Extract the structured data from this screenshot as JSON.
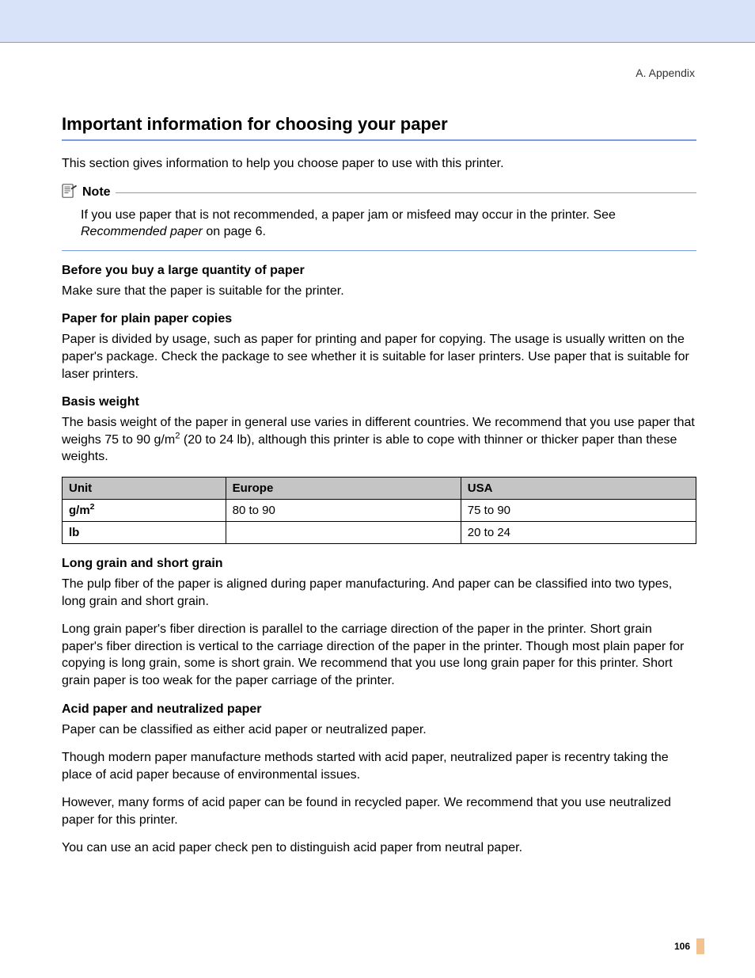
{
  "breadcrumb": "A. Appendix",
  "title": "Important information for choosing your paper",
  "intro": "This section gives information to help you choose paper to use with this printer.",
  "note": {
    "label": "Note",
    "body_prefix": "If you use paper that is not recommended, a paper jam or misfeed may occur in the printer. See ",
    "body_link": "Recommended paper",
    "body_suffix": " on page 6."
  },
  "sections": {
    "before_buy": {
      "heading": "Before you buy a large quantity of paper",
      "p1": "Make sure that the paper is suitable for the printer."
    },
    "plain_paper": {
      "heading": "Paper for plain paper copies",
      "p1": "Paper is divided by usage, such as paper for printing and paper for copying. The usage is usually written on the paper's package. Check the package to see whether it is suitable for laser printers. Use paper that is suitable for laser printers."
    },
    "basis_weight": {
      "heading": "Basis weight",
      "p1_a": "The basis weight of the paper in general use varies in different countries. We recommend that you use paper that weighs 75 to 90 g/m",
      "p1_b": " (20 to 24 lb), although this printer is able to cope with thinner or thicker paper than these weights."
    },
    "grain": {
      "heading": "Long grain and short grain",
      "p1": "The pulp fiber of the paper is aligned during paper manufacturing. And paper can be classified into two types, long grain and short grain.",
      "p2": "Long grain paper's fiber direction is parallel to the carriage direction of the paper in the printer. Short grain paper's fiber direction is vertical to the carriage direction of the paper in the printer. Though most plain paper for copying is long grain, some is short grain. We recommend that you use long grain paper for this printer. Short grain paper is too weak for the paper carriage of the printer."
    },
    "acid": {
      "heading": "Acid paper and neutralized paper",
      "p1": "Paper can be classified as either acid paper or neutralized paper.",
      "p2": "Though modern paper manufacture methods started with acid paper, neutralized paper is recentry taking the place of acid paper because of environmental issues.",
      "p3": "However, many forms of acid paper can be found in recycled paper. We recommend that you use neutralized paper for this printer.",
      "p4": "You can use an acid paper check pen to distinguish acid paper from neutral paper."
    }
  },
  "table": {
    "headers": {
      "c0": "Unit",
      "c1": "Europe",
      "c2": "USA"
    },
    "rows": [
      {
        "unit_pre": "g/m",
        "unit_sup": "2",
        "europe": "80 to 90",
        "usa": "75 to 90"
      },
      {
        "unit_pre": "lb",
        "unit_sup": "",
        "europe": "",
        "usa": "20 to 24"
      }
    ]
  },
  "page_number": "106"
}
